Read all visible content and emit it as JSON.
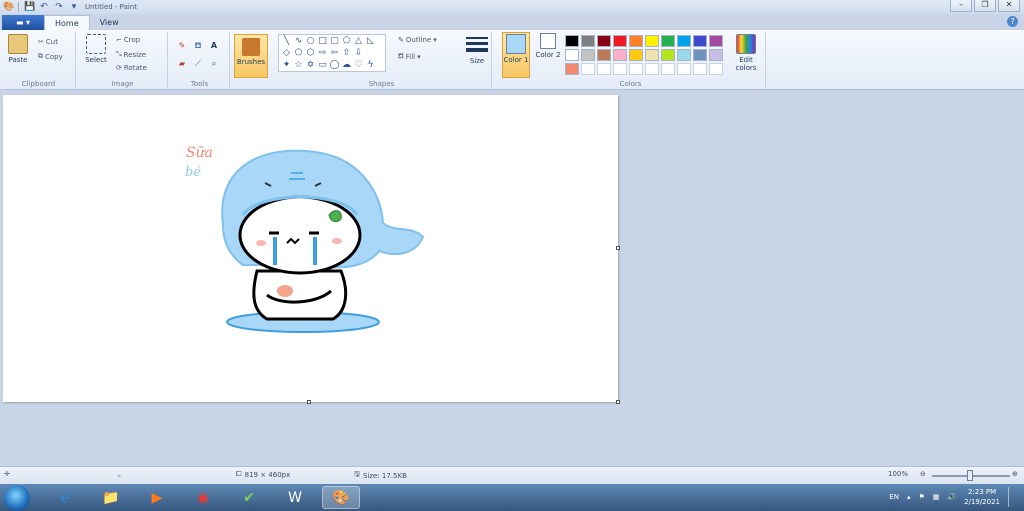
{
  "window": {
    "title": "Untitled - Paint"
  },
  "tabs": {
    "file": "",
    "home": "Home",
    "view": "View"
  },
  "ribbon": {
    "clipboard": {
      "label": "Clipboard",
      "paste": "Paste",
      "cut": "Cut",
      "copy": "Copy"
    },
    "image": {
      "label": "Image",
      "select": "Select",
      "crop": "Crop",
      "resize": "Resize",
      "rotate": "Rotate"
    },
    "tools": {
      "label": "Tools",
      "brushes": "Brushes"
    },
    "shapes": {
      "label": "Shapes",
      "outline": "Outline",
      "fill": "Fill",
      "size": "Size"
    },
    "colors": {
      "label": "Colors",
      "color1": "Color 1",
      "color2": "Color 2",
      "edit": "Edit colors",
      "color1_value": "#a9d7f7",
      "color2_value": "#ffffff",
      "palette": [
        "#000000",
        "#7f7f7f",
        "#880015",
        "#ed1c24",
        "#ff7f27",
        "#fff200",
        "#22b14c",
        "#00a2e8",
        "#3f48cc",
        "#a349a4",
        "#ffffff",
        "#c3c3c3",
        "#b97a57",
        "#ffaec9",
        "#ffc90e",
        "#efe4b0",
        "#b5e61d",
        "#99d9ea",
        "#7092be",
        "#c8bfe7",
        "#f08a70",
        "#ffffff",
        "#ffffff",
        "#ffffff",
        "#ffffff",
        "#ffffff",
        "#ffffff",
        "#ffffff",
        "#ffffff",
        "#ffffff"
      ]
    }
  },
  "canvas": {
    "doodle_text_top": "Sữa",
    "doodle_text_bottom": "bé"
  },
  "status": {
    "dimensions": "819 × 460px",
    "size": "Size: 17.5KB",
    "zoom": "100%"
  },
  "taskbar": {
    "language": "EN",
    "time": "2:23 PM",
    "date": "2/19/2021"
  }
}
